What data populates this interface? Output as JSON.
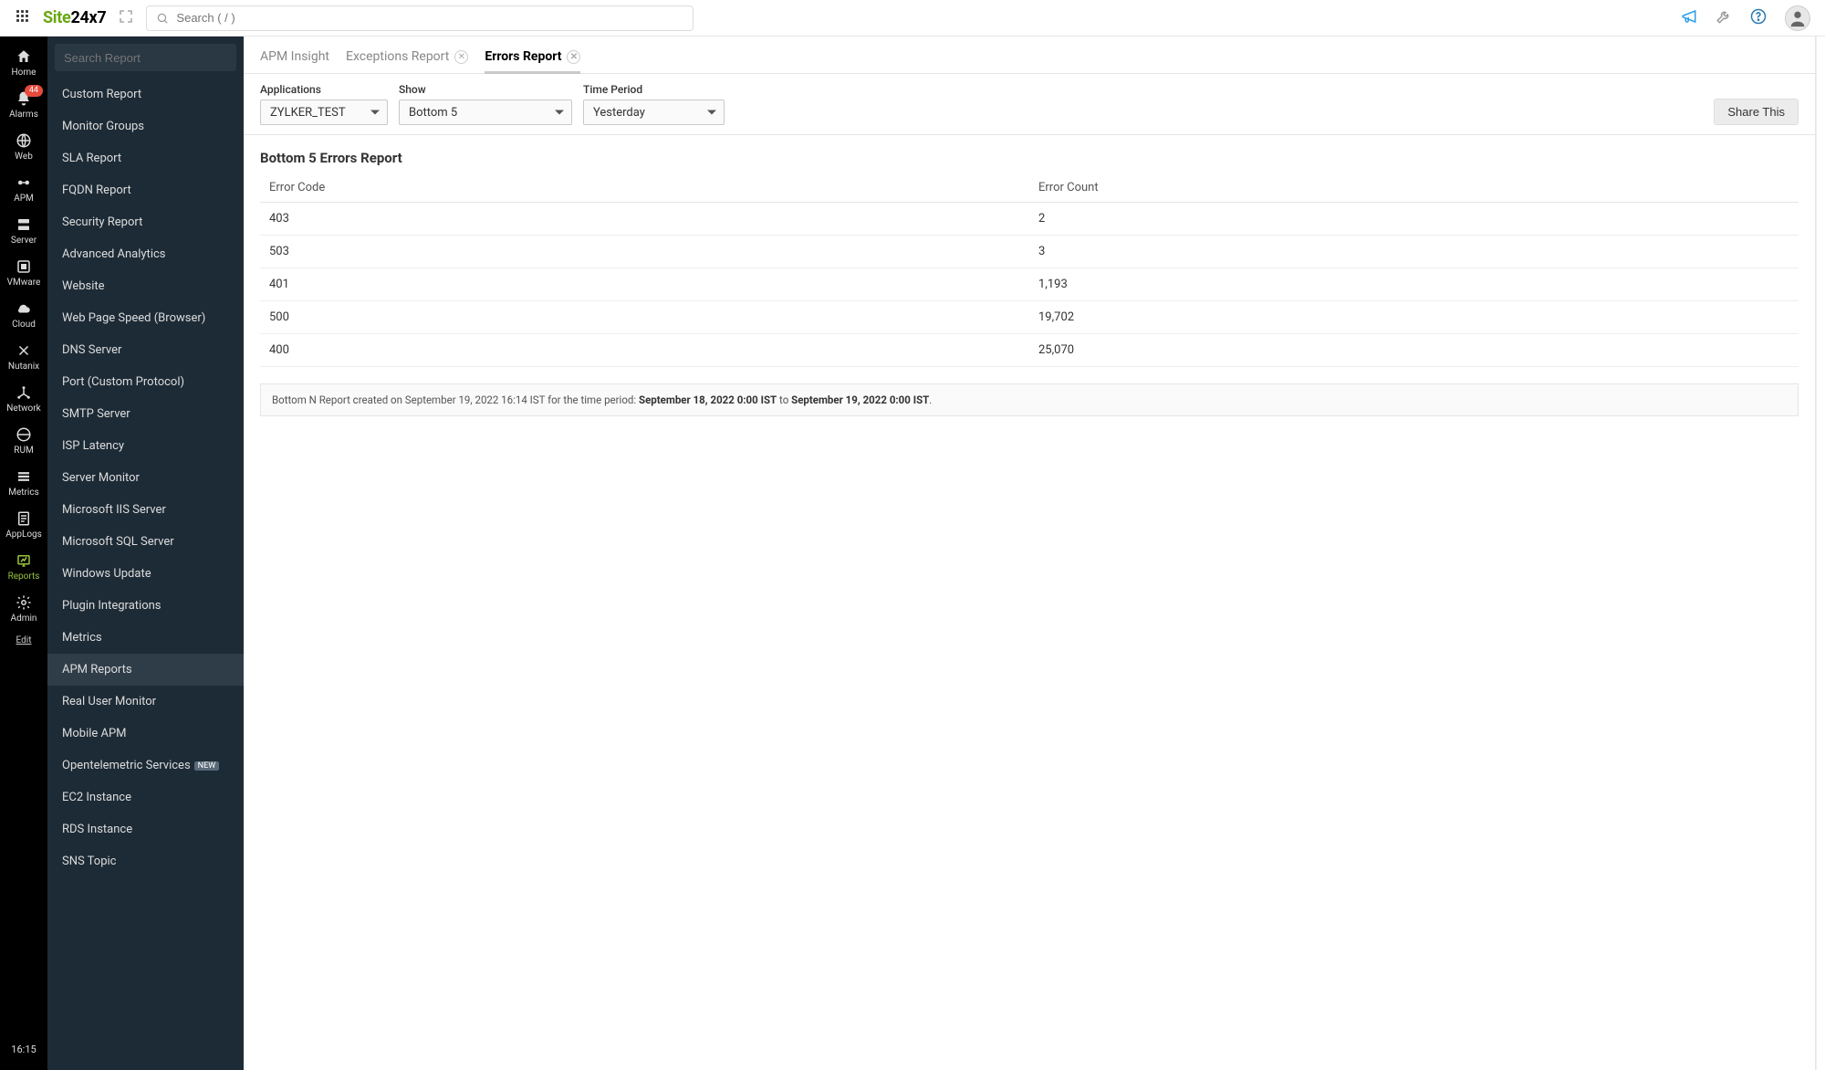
{
  "top": {
    "logo_green": "Site",
    "logo_black": "24x7",
    "search_placeholder": "Search ( / )"
  },
  "rail": {
    "items": [
      {
        "label": "Home"
      },
      {
        "label": "Alarms",
        "badge": "44"
      },
      {
        "label": "Web"
      },
      {
        "label": "APM"
      },
      {
        "label": "Server"
      },
      {
        "label": "VMware"
      },
      {
        "label": "Cloud"
      },
      {
        "label": "Nutanix"
      },
      {
        "label": "Network"
      },
      {
        "label": "RUM"
      },
      {
        "label": "Metrics"
      },
      {
        "label": "AppLogs"
      },
      {
        "label": "Reports"
      },
      {
        "label": "Admin"
      }
    ],
    "edit": "Edit",
    "clock": "16:15"
  },
  "sidebar": {
    "search_placeholder": "Search Report",
    "items": [
      {
        "label": "Custom Report"
      },
      {
        "label": "Monitor Groups"
      },
      {
        "label": "SLA Report"
      },
      {
        "label": "FQDN Report"
      },
      {
        "label": "Security Report"
      },
      {
        "label": "Advanced Analytics"
      },
      {
        "label": "Website"
      },
      {
        "label": "Web Page Speed (Browser)"
      },
      {
        "label": "DNS Server"
      },
      {
        "label": "Port (Custom Protocol)"
      },
      {
        "label": "SMTP Server"
      },
      {
        "label": "ISP Latency"
      },
      {
        "label": "Server Monitor"
      },
      {
        "label": "Microsoft IIS Server"
      },
      {
        "label": "Microsoft SQL Server"
      },
      {
        "label": "Windows Update"
      },
      {
        "label": "Plugin Integrations"
      },
      {
        "label": "Metrics"
      },
      {
        "label": "APM Reports",
        "selected": true
      },
      {
        "label": "Real User Monitor"
      },
      {
        "label": "Mobile APM"
      },
      {
        "label": "Opentelemetric Services",
        "tag": "NEW"
      },
      {
        "label": "EC2 Instance"
      },
      {
        "label": "RDS Instance"
      },
      {
        "label": "SNS Topic"
      }
    ]
  },
  "tabs": [
    {
      "label": "APM Insight",
      "closable": false
    },
    {
      "label": "Exceptions Report",
      "closable": true
    },
    {
      "label": "Errors Report",
      "closable": true,
      "active": true
    }
  ],
  "filters": {
    "applications": {
      "label": "Applications",
      "value": "ZYLKER_TEST"
    },
    "show": {
      "label": "Show",
      "value": "Bottom 5"
    },
    "time_period": {
      "label": "Time Period",
      "value": "Yesterday"
    },
    "share": "Share This"
  },
  "report": {
    "title": "Bottom 5 Errors Report",
    "columns": [
      "Error Code",
      "Error Count"
    ],
    "rows": [
      {
        "code": "403",
        "count": "2"
      },
      {
        "code": "503",
        "count": "3"
      },
      {
        "code": "401",
        "count": "1,193"
      },
      {
        "code": "500",
        "count": "19,702"
      },
      {
        "code": "400",
        "count": "25,070"
      }
    ],
    "footer_prefix": "Bottom N Report created on September 19, 2022 16:14 IST for the time period: ",
    "footer_start": "September 18, 2022 0:00 IST",
    "footer_mid": " to ",
    "footer_end": "September 19, 2022 0:00 IST",
    "footer_suffix": "."
  }
}
